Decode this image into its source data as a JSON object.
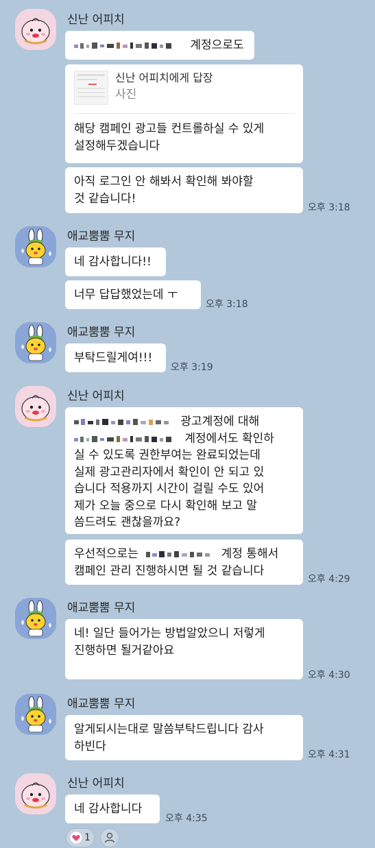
{
  "colors": {
    "background": "#b2c7da",
    "bubble": "#ffffff",
    "heart": "#e64980"
  },
  "messages": [
    {
      "sender": "신난 어피치",
      "avatar": "apeach-avatar",
      "lines": [
        "계정으로도"
      ]
    },
    {
      "reply_to": "신난 어피치에게 답장",
      "reply_type": "사진",
      "lines": [
        "해당 캠페인 광고들 컨트롤하실 수 있게",
        "설정해두겠습니다"
      ]
    },
    {
      "lines": [
        "아직 로그인 안 해봐서 확인해 봐야할",
        "것 같습니다!"
      ],
      "time": "오후 3:18"
    },
    {
      "sender": "애교뿜뿜 무지",
      "avatar": "muzi-avatar",
      "lines": [
        "네 감사합니다!!"
      ]
    },
    {
      "lines": [
        "너무 답답했었는데 ㅜ"
      ],
      "time": "오후 3:18"
    },
    {
      "sender": "애교뿜뿜 무지",
      "avatar": "muzi-avatar",
      "lines": [
        "부탁드릴게여!!!"
      ],
      "time": "오후 3:19"
    },
    {
      "sender": "신난 어피치",
      "avatar": "apeach-avatar",
      "lines": [
        "광고계정에 대해",
        "계정에서도 확인하",
        "실 수 있도록 권한부여는 완료되었는데",
        "실제 광고관리자에서 확인이 안 되고 있",
        "습니다 적용까지 시간이 걸릴 수도 있어",
        "제가 오늘 중으로 다시 확인해 보고 말",
        "씀드려도 괜찮을까요?"
      ]
    },
    {
      "lines": [
        "우선적으로는",
        "계정 통해서",
        "캠페인 관리 진행하시면 될 것 같습니다"
      ],
      "time": "오후 4:29"
    },
    {
      "sender": "애교뿜뿜 무지",
      "avatar": "muzi-avatar",
      "lines": [
        "네! 일단 들어가는 방법알았으니 저렇게",
        "진행하면 될거같아요"
      ],
      "time": "오후 4:30"
    },
    {
      "sender": "애교뿜뿜 무지",
      "avatar": "muzi-avatar",
      "lines": [
        "알게되시는대로 말씀부탁드립니다 감사",
        "하빈다"
      ],
      "time": "오후 4:31"
    },
    {
      "sender": "신난 어피치",
      "avatar": "apeach-avatar",
      "lines": [
        "네 감사합니다"
      ],
      "time": "오후 4:35"
    }
  ],
  "reactions": {
    "heart_count": "1",
    "heart_icon": "heart-icon",
    "add_icon": "person-icon"
  }
}
